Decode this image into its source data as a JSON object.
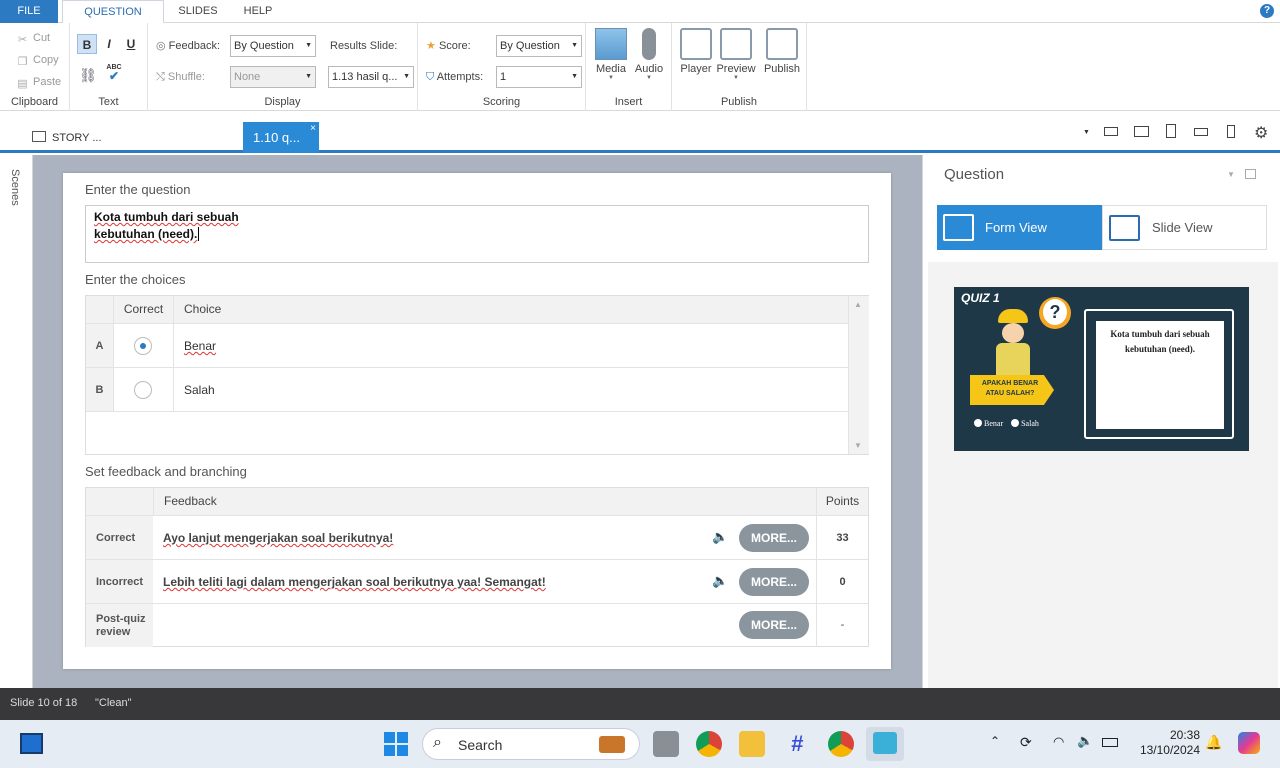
{
  "menu": {
    "file": "FILE",
    "tabs": [
      "QUESTION",
      "SLIDES",
      "HELP"
    ],
    "help": "?"
  },
  "ribbon": {
    "clipboard": {
      "cut": "Cut",
      "copy": "Copy",
      "paste": "Paste",
      "label": "Clipboard"
    },
    "text": {
      "bold": "B",
      "italic": "I",
      "underline": "U",
      "label": "Text",
      "spell": "ABC"
    },
    "display": {
      "feedback_label": "Feedback:",
      "feedback_value": "By Question",
      "shuffle_label": "Shuffle:",
      "shuffle_value": "None",
      "results_label": "Results Slide:",
      "results_value": "1.13 hasil q...",
      "label": "Display"
    },
    "scoring": {
      "score_label": "Score:",
      "score_value": "By Question",
      "attempts_label": "Attempts:",
      "attempts_value": "1",
      "label": "Scoring"
    },
    "insert": {
      "media": "Media",
      "audio": "Audio",
      "label": "Insert"
    },
    "publish": {
      "player": "Player",
      "preview": "Preview",
      "publish": "Publish",
      "label": "Publish"
    }
  },
  "tabs": {
    "story": "STORY ...",
    "slide": "1.10 q...",
    "close": "×"
  },
  "scenes": "Scenes",
  "editor": {
    "question_heading": "Enter the question",
    "question_line1": "Kota tumbuh dari sebuah",
    "question_line2": "kebutuhan (need).",
    "choices_heading": "Enter the choices",
    "col_correct": "Correct",
    "col_choice": "Choice",
    "choices": [
      {
        "letter": "A",
        "text": "Benar",
        "selected": true
      },
      {
        "letter": "B",
        "text": "Salah",
        "selected": false
      }
    ],
    "feedback_heading": "Set feedback and branching",
    "col_feedback": "Feedback",
    "col_points": "Points",
    "feedback_rows": [
      {
        "label": "Correct",
        "text": "Ayo lanjut mengerjakan soal berikutnya!",
        "more": "MORE...",
        "points": "33"
      },
      {
        "label": "Incorrect",
        "text": "Lebih teliti lagi dalam mengerjakan soal berikutnya yaa! Semangat!",
        "more": "MORE...",
        "points": "0"
      },
      {
        "label": "Post-quiz review",
        "text": "",
        "more": "MORE...",
        "points": "-"
      }
    ]
  },
  "right_panel": {
    "title": "Question",
    "form_view": "Form View",
    "slide_view": "Slide View",
    "thumb": {
      "quiz": "QUIZ 1",
      "badge_line1": "APAKAH BENAR",
      "badge_line2": "ATAU SALAH?",
      "card_line1": "Kota tumbuh dari sebuah",
      "card_line2": "kebutuhan (need).",
      "opt1": "Benar",
      "opt2": "Salah"
    }
  },
  "status": {
    "slide": "Slide 10 of 18",
    "theme": "\"Clean\""
  },
  "taskbar": {
    "search": "Search",
    "time": "20:38",
    "date": "13/10/2024"
  },
  "colors": {
    "accent": "#2b8ad6",
    "status_bg": "#38383a"
  }
}
